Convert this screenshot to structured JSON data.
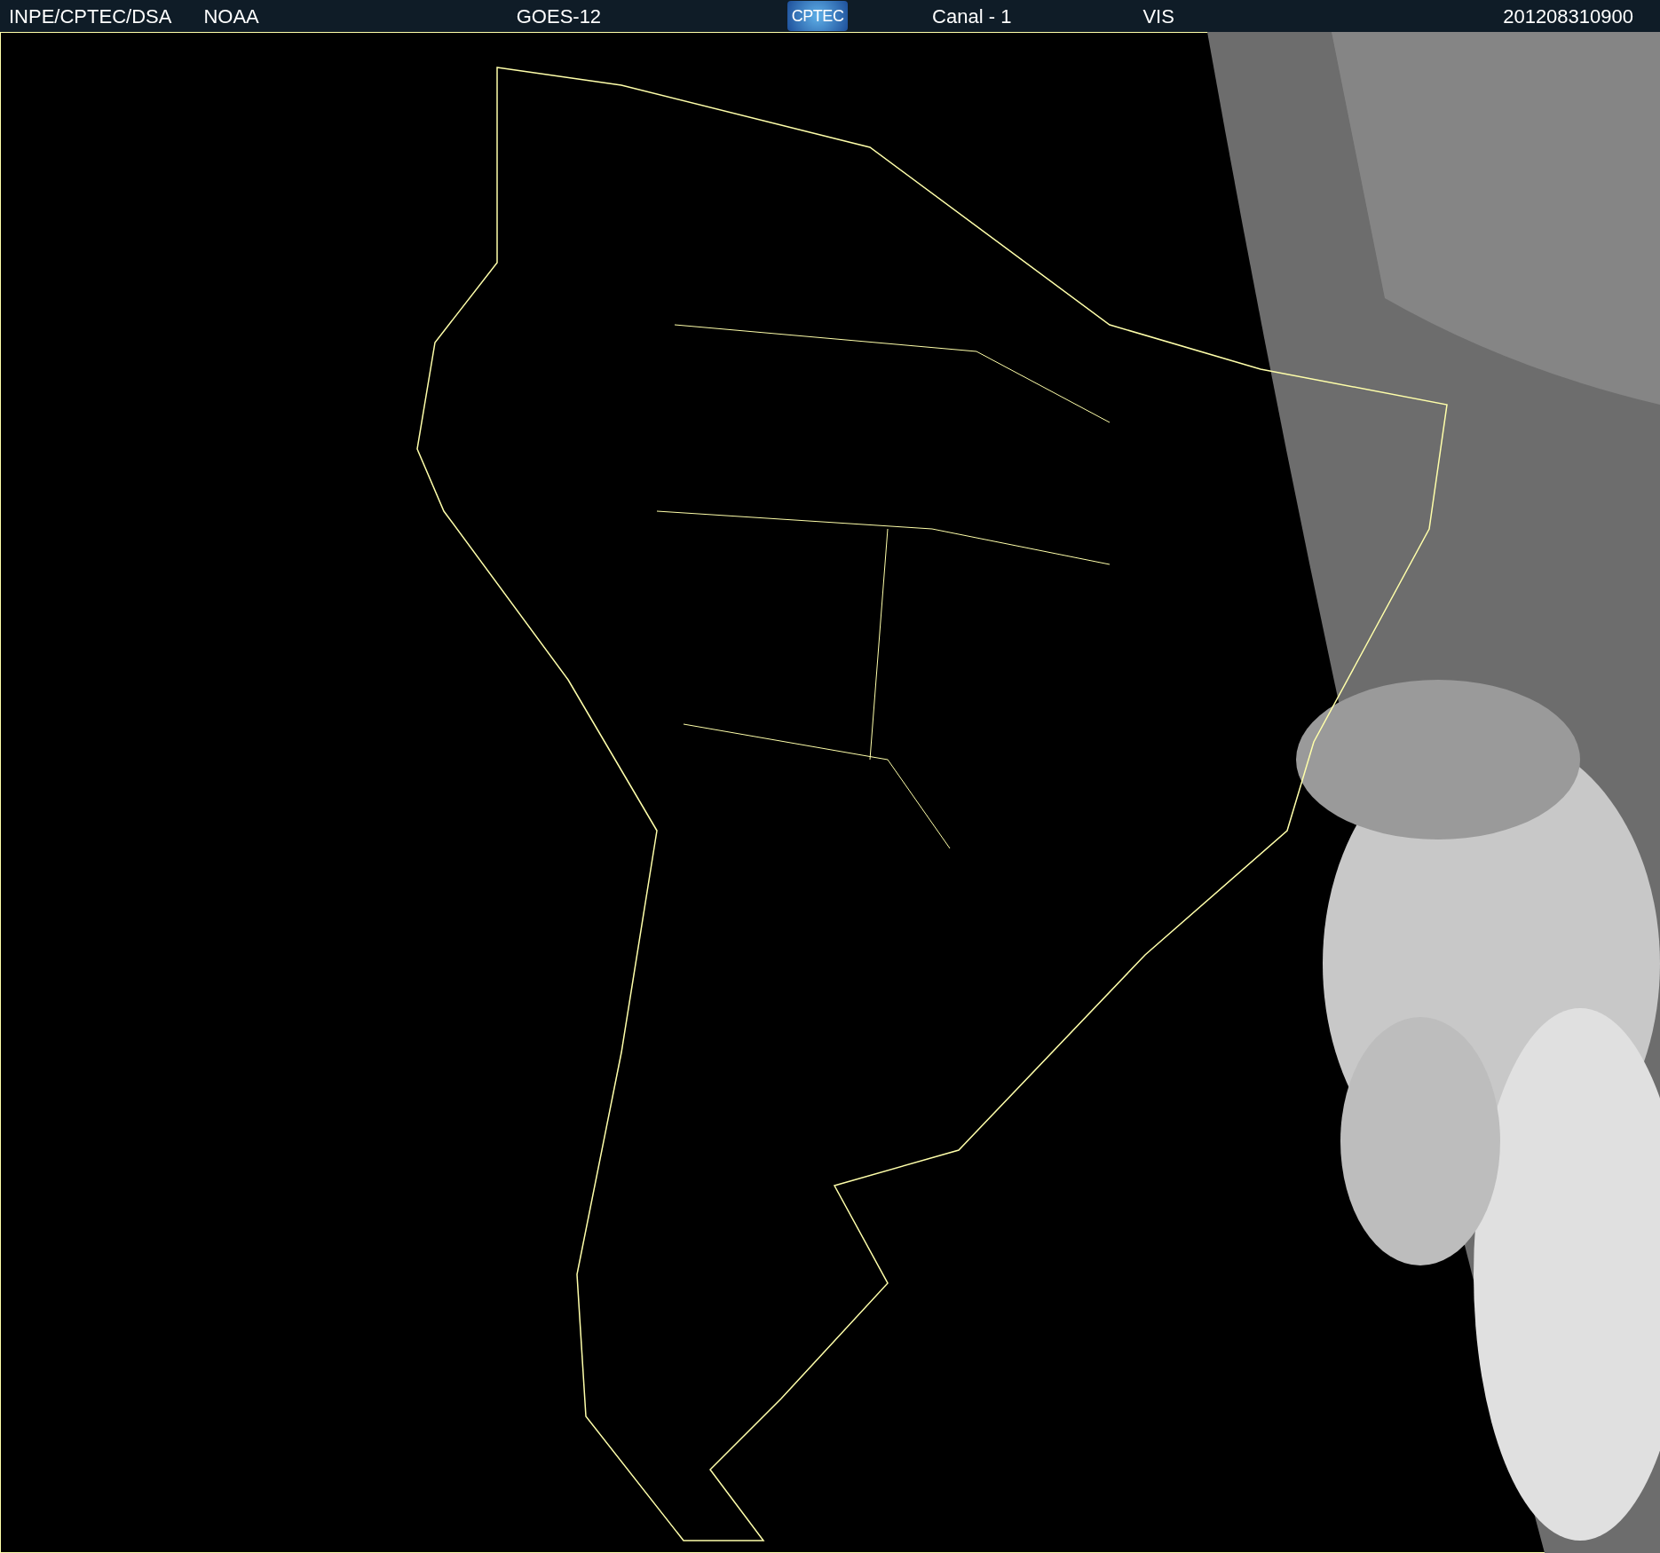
{
  "header": {
    "left": [
      "INPE/CPTEC/DSA",
      "NOAA"
    ],
    "satellite": "GOES-12",
    "logo": "CPTEC",
    "channel": "Canal - 1",
    "band": "VIS",
    "timestamp": "201208310900"
  }
}
